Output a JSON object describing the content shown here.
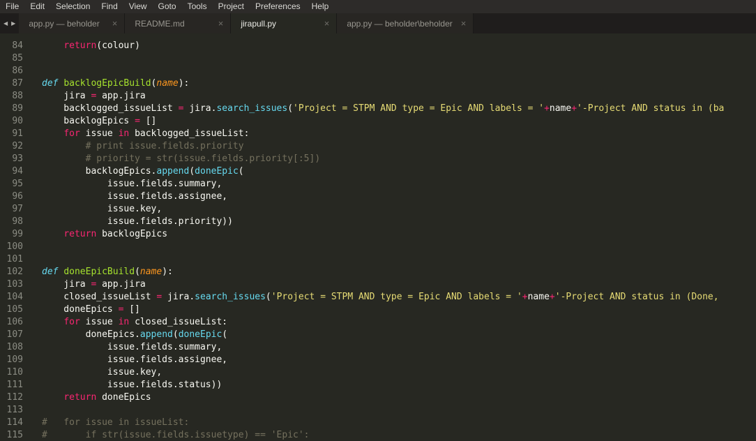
{
  "menu": {
    "items": [
      "File",
      "Edit",
      "Selection",
      "Find",
      "View",
      "Goto",
      "Tools",
      "Project",
      "Preferences",
      "Help"
    ]
  },
  "tabs": {
    "scroll_left": "◀",
    "scroll_right": "▶",
    "close_glyph": "×",
    "items": [
      {
        "label": "app.py — beholder",
        "active": false
      },
      {
        "label": "README.md",
        "active": false
      },
      {
        "label": "jirapull.py",
        "active": true
      },
      {
        "label": "app.py — beholder\\beholder",
        "active": false
      }
    ]
  },
  "colors": {
    "editor_background": "#272822",
    "gutter_foreground": "#8b8c83",
    "plain": "#f8f8f2",
    "keyword": "#f92672",
    "storage": "#66d9ef",
    "function_name": "#a6e22e",
    "parameter": "#fd971f",
    "string": "#e6db74",
    "comment": "#75715e"
  },
  "editor": {
    "first_line_number": 84,
    "last_line_number": 115,
    "lines": [
      {
        "num": 84,
        "tokens": [
          [
            "plain",
            "    "
          ],
          [
            "kw",
            "return"
          ],
          [
            "plain",
            "(colour)"
          ]
        ]
      },
      {
        "num": 85,
        "tokens": []
      },
      {
        "num": 86,
        "tokens": []
      },
      {
        "num": 87,
        "tokens": [
          [
            "def",
            "def"
          ],
          [
            "plain",
            " "
          ],
          [
            "fn",
            "backlogEpicBuild"
          ],
          [
            "plain",
            "("
          ],
          [
            "param",
            "name"
          ],
          [
            "plain",
            "):"
          ]
        ]
      },
      {
        "num": 88,
        "tokens": [
          [
            "plain",
            "    jira "
          ],
          [
            "op",
            "="
          ],
          [
            "plain",
            " app.jira"
          ]
        ]
      },
      {
        "num": 89,
        "tokens": [
          [
            "plain",
            "    backlogged_issueList "
          ],
          [
            "op",
            "="
          ],
          [
            "plain",
            " jira."
          ],
          [
            "call",
            "search_issues"
          ],
          [
            "plain",
            "("
          ],
          [
            "str",
            "'Project = STPM AND type = Epic AND labels = '"
          ],
          [
            "op",
            "+"
          ],
          [
            "plain",
            "name"
          ],
          [
            "op",
            "+"
          ],
          [
            "str",
            "'-Project AND status in (ba"
          ]
        ]
      },
      {
        "num": 90,
        "tokens": [
          [
            "plain",
            "    backlogEpics "
          ],
          [
            "op",
            "="
          ],
          [
            "plain",
            " []"
          ]
        ]
      },
      {
        "num": 91,
        "tokens": [
          [
            "plain",
            "    "
          ],
          [
            "kw",
            "for"
          ],
          [
            "plain",
            " issue "
          ],
          [
            "kw",
            "in"
          ],
          [
            "plain",
            " backlogged_issueList:"
          ]
        ]
      },
      {
        "num": 92,
        "tokens": [
          [
            "com",
            "        # print issue.fields.priority"
          ]
        ]
      },
      {
        "num": 93,
        "tokens": [
          [
            "com",
            "        # priority = str(issue.fields.priority[:5])"
          ]
        ]
      },
      {
        "num": 94,
        "tokens": [
          [
            "plain",
            "        backlogEpics."
          ],
          [
            "call",
            "append"
          ],
          [
            "plain",
            "("
          ],
          [
            "call",
            "doneEpic"
          ],
          [
            "plain",
            "("
          ]
        ]
      },
      {
        "num": 95,
        "tokens": [
          [
            "plain",
            "            issue.fields.summary,"
          ]
        ]
      },
      {
        "num": 96,
        "tokens": [
          [
            "plain",
            "            issue.fields.assignee,"
          ]
        ]
      },
      {
        "num": 97,
        "tokens": [
          [
            "plain",
            "            issue.key,"
          ]
        ]
      },
      {
        "num": 98,
        "tokens": [
          [
            "plain",
            "            issue.fields.priority))"
          ]
        ]
      },
      {
        "num": 99,
        "tokens": [
          [
            "plain",
            "    "
          ],
          [
            "kw",
            "return"
          ],
          [
            "plain",
            " backlogEpics"
          ]
        ]
      },
      {
        "num": 100,
        "tokens": []
      },
      {
        "num": 101,
        "tokens": []
      },
      {
        "num": 102,
        "tokens": [
          [
            "def",
            "def"
          ],
          [
            "plain",
            " "
          ],
          [
            "fn",
            "doneEpicBuild"
          ],
          [
            "plain",
            "("
          ],
          [
            "param",
            "name"
          ],
          [
            "plain",
            "):"
          ]
        ]
      },
      {
        "num": 103,
        "tokens": [
          [
            "plain",
            "    jira "
          ],
          [
            "op",
            "="
          ],
          [
            "plain",
            " app.jira"
          ]
        ]
      },
      {
        "num": 104,
        "tokens": [
          [
            "plain",
            "    closed_issueList "
          ],
          [
            "op",
            "="
          ],
          [
            "plain",
            " jira."
          ],
          [
            "call",
            "search_issues"
          ],
          [
            "plain",
            "("
          ],
          [
            "str",
            "'Project = STPM AND type = Epic AND labels = '"
          ],
          [
            "op",
            "+"
          ],
          [
            "plain",
            "name"
          ],
          [
            "op",
            "+"
          ],
          [
            "str",
            "'-Project AND status in (Done,"
          ]
        ]
      },
      {
        "num": 105,
        "tokens": [
          [
            "plain",
            "    doneEpics "
          ],
          [
            "op",
            "="
          ],
          [
            "plain",
            " []"
          ]
        ]
      },
      {
        "num": 106,
        "tokens": [
          [
            "plain",
            "    "
          ],
          [
            "kw",
            "for"
          ],
          [
            "plain",
            " issue "
          ],
          [
            "kw",
            "in"
          ],
          [
            "plain",
            " closed_issueList:"
          ]
        ]
      },
      {
        "num": 107,
        "tokens": [
          [
            "plain",
            "        doneEpics."
          ],
          [
            "call",
            "append"
          ],
          [
            "plain",
            "("
          ],
          [
            "call",
            "doneEpic"
          ],
          [
            "plain",
            "("
          ]
        ]
      },
      {
        "num": 108,
        "tokens": [
          [
            "plain",
            "            issue.fields.summary,"
          ]
        ]
      },
      {
        "num": 109,
        "tokens": [
          [
            "plain",
            "            issue.fields.assignee,"
          ]
        ]
      },
      {
        "num": 110,
        "tokens": [
          [
            "plain",
            "            issue.key,"
          ]
        ]
      },
      {
        "num": 111,
        "tokens": [
          [
            "plain",
            "            issue.fields.status))"
          ]
        ]
      },
      {
        "num": 112,
        "tokens": [
          [
            "plain",
            "    "
          ],
          [
            "kw",
            "return"
          ],
          [
            "plain",
            " doneEpics"
          ]
        ]
      },
      {
        "num": 113,
        "tokens": []
      },
      {
        "num": 114,
        "tokens": [
          [
            "com",
            "#   for issue in issueList:"
          ]
        ]
      },
      {
        "num": 115,
        "tokens": [
          [
            "com",
            "#       if str(issue.fields.issuetype) == 'Epic':"
          ]
        ]
      }
    ]
  }
}
